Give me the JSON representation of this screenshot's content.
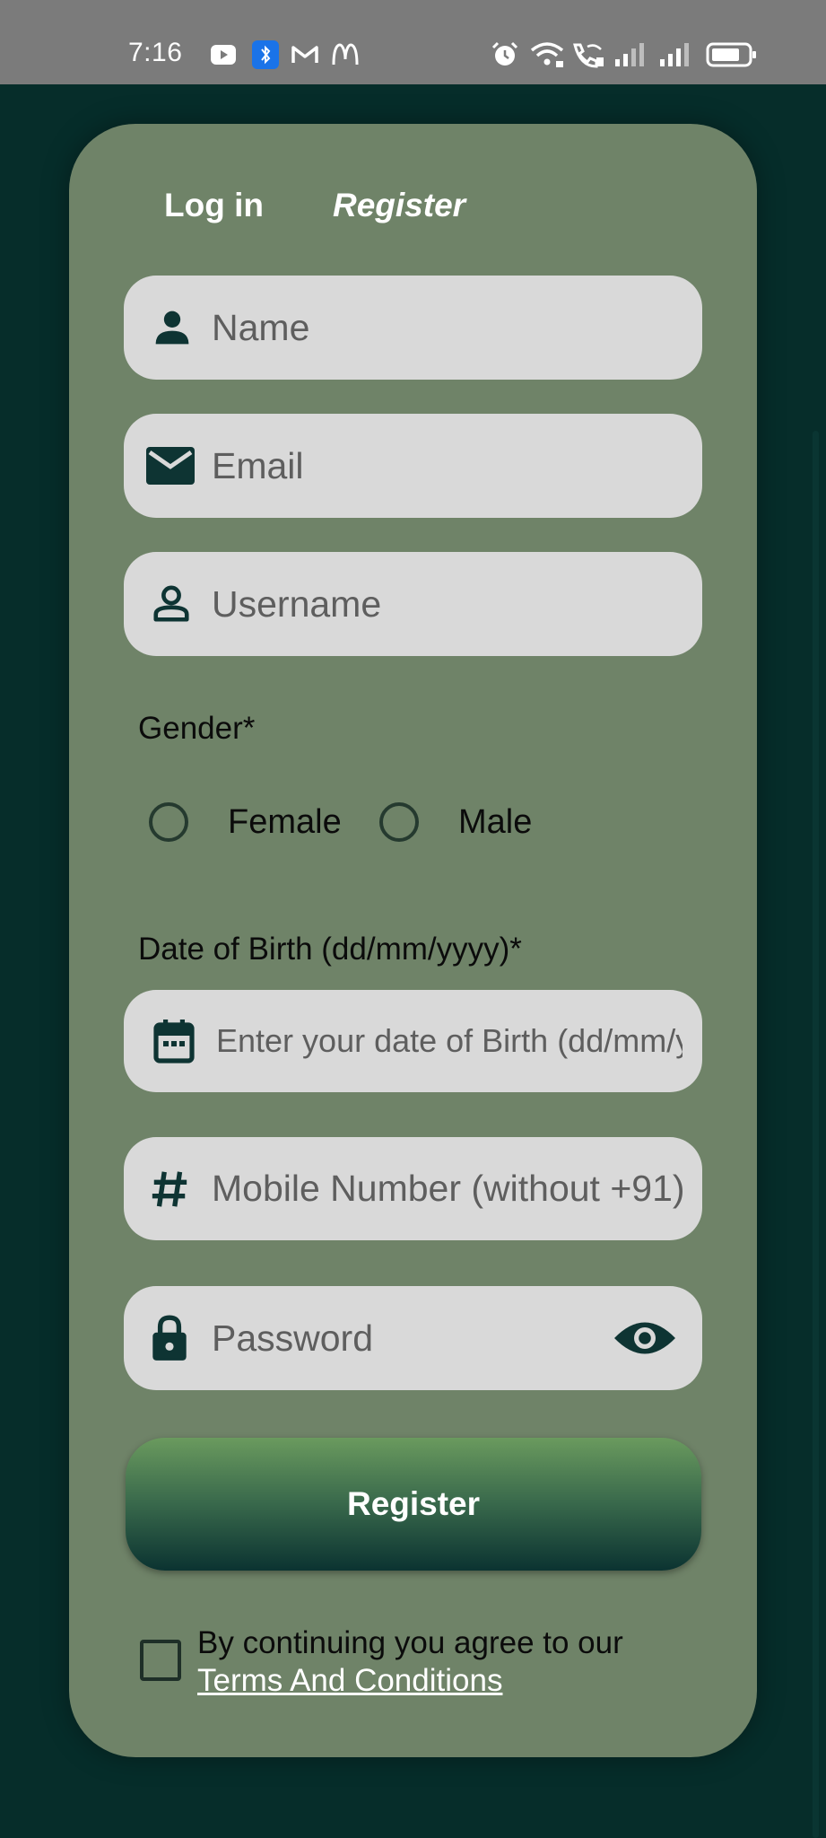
{
  "status_bar": {
    "time": "7:16",
    "icons": [
      "youtube-icon",
      "bluetooth-icon",
      "gmail-icon",
      "mcdonalds-icon",
      "alarm-icon",
      "wifi-icon",
      "call-wifi-icon",
      "signal-icon",
      "signal-icon",
      "battery-icon"
    ]
  },
  "tabs": {
    "login": "Log in",
    "register": "Register"
  },
  "fields": {
    "name": {
      "placeholder": "Name"
    },
    "email": {
      "placeholder": "Email"
    },
    "username": {
      "placeholder": "Username"
    },
    "dob": {
      "placeholder": "Enter your date of Birth (dd/mm/yyyy)"
    },
    "mobile": {
      "placeholder": "Mobile Number (without +91)"
    },
    "password": {
      "placeholder": "Password"
    }
  },
  "gender": {
    "label": "Gender*",
    "options": [
      "Female",
      "Male"
    ]
  },
  "dob_label": "Date of Birth (dd/mm/yyyy)*",
  "register_button": "Register",
  "terms": {
    "text": "By continuing you agree to our",
    "link": "Terms And Conditions"
  },
  "colors": {
    "background": "#062d2a",
    "card": "#6f8368",
    "field": "#d9d9d9",
    "icon": "#0e3433",
    "button_top": "#6a9a5e",
    "button_bottom": "#0b3331"
  }
}
